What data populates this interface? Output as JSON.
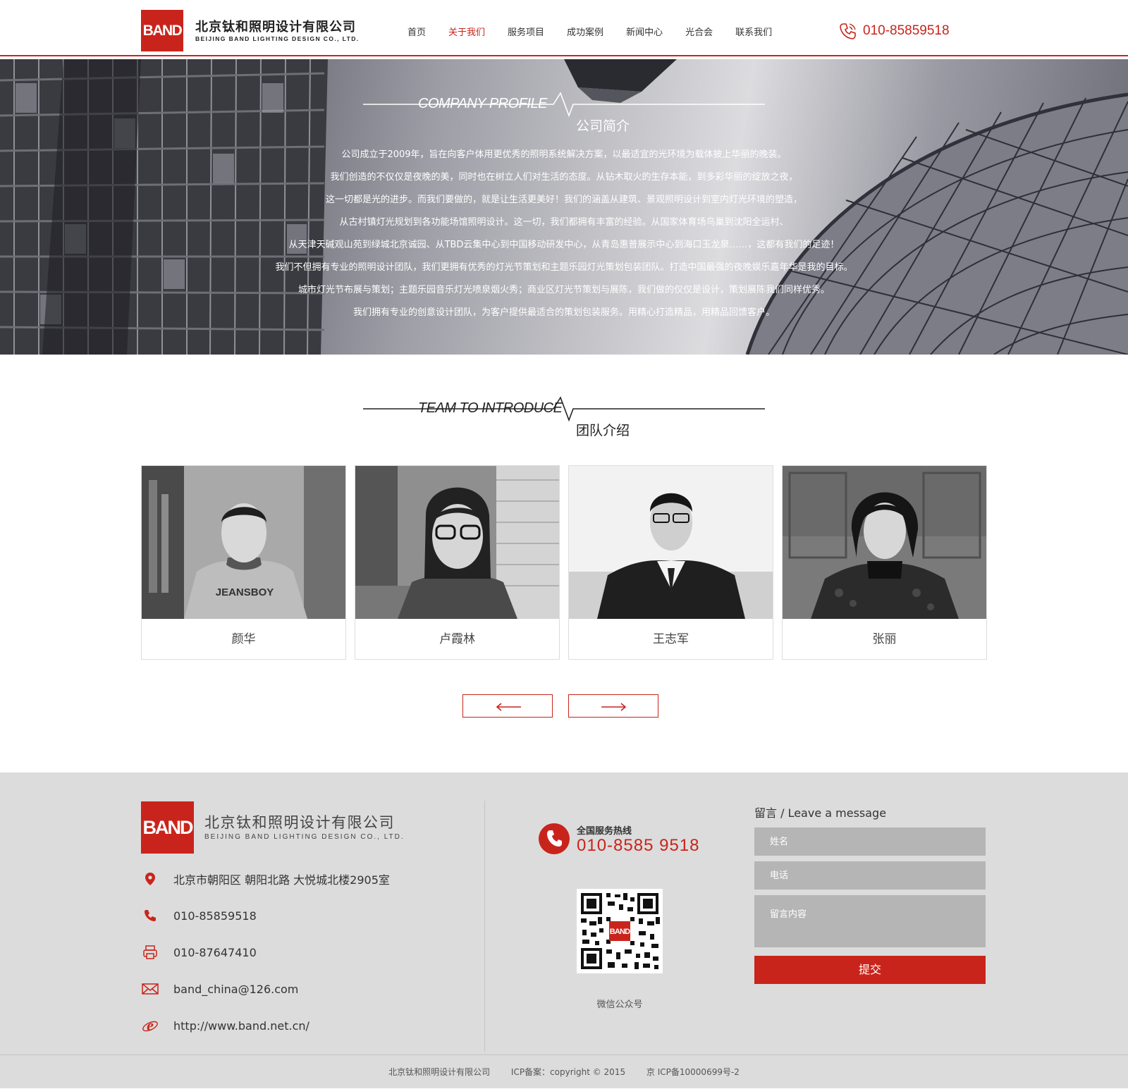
{
  "header": {
    "logo_text": "BAND",
    "company_cn": "北京钛和照明设计有限公司",
    "company_en": "BEIJING BAND LIGHTING DESIGN CO., LTD.",
    "nav": [
      {
        "label": "首页",
        "active": false
      },
      {
        "label": "关于我们",
        "active": true
      },
      {
        "label": "服务项目",
        "active": false
      },
      {
        "label": "成功案例",
        "active": false
      },
      {
        "label": "新闻中心",
        "active": false
      },
      {
        "label": "光合会",
        "active": false
      },
      {
        "label": "联系我们",
        "active": false
      }
    ],
    "phone": "010-85859518"
  },
  "profile": {
    "title_en": "COMPANY PROFILE",
    "title_cn": "公司简介",
    "lines": [
      "公司成立于2009年，旨在向客户体用更优秀的照明系统解决方案，以最适宜的光环境为载体披上华丽的晚装。",
      "我们创造的不仅仅是夜晚的美，同时也在树立人们对生活的态度。从钻木取火的生存本能，到多彩华丽的绽放之夜，",
      "这一切都是光的进步。而我们要做的，就是让生活更美好！我们的涵盖从建筑、景观照明设计到室内灯光环境的塑造，",
      "从古村镇灯光规划到各功能场馆照明设计。这一切，我们都拥有丰富的经验。从国家体育场鸟巢到沈阳全运村、",
      "从天津天碱观山苑到绿城北京诚园、从TBD云集中心到中国移动研发中心，从青岛惠普展示中心到海口玉龙泉……，这都有我们的足迹！",
      "我们不但拥有专业的照明设计团队，我们更拥有优秀的灯光节策划和主题乐园灯光策划包装团队。打造中国最强的夜晚娱乐嘉年华是我的目标。",
      "城市灯光节布展与策划；主题乐园音乐灯光喷泉烟火秀；商业区灯光节策划与展陈，我们做的仅仅是设计，策划展陈我们同样优秀。",
      "我们拥有专业的创意设计团队，为客户提供最适合的策划包装服务。用精心打造精品，用精品回馈客户。"
    ]
  },
  "team": {
    "title_en": "TEAM TO INTRODUCE",
    "title_cn": "团队介绍",
    "members": [
      {
        "name": "颜华",
        "shirt_text": "JEANSBOY"
      },
      {
        "name": "卢霞林"
      },
      {
        "name": "王志军"
      },
      {
        "name": "张丽"
      }
    ],
    "prev_icon": "arrow-left-icon",
    "next_icon": "arrow-right-icon"
  },
  "footer": {
    "logo_text": "BAND",
    "company_cn": "北京钛和照明设计有限公司",
    "company_en": "BEIJING BAND LIGHTING DESIGN CO., LTD.",
    "contacts": [
      {
        "icon": "location-pin-icon",
        "text": "北京市朝阳区 朝阳北路 大悦城北楼2905室"
      },
      {
        "icon": "phone-icon",
        "text": "010-85859518"
      },
      {
        "icon": "fax-printer-icon",
        "text": "010-87647410"
      },
      {
        "icon": "mail-icon",
        "text": "band_china@126.com"
      },
      {
        "icon": "browser-icon",
        "text": "http://www.band.net.cn/"
      }
    ],
    "hotline_label": "全国服务热线",
    "hotline_number": "010-8585 9518",
    "qr_logo_text": "BAND",
    "qr_label": "微信公众号",
    "message": {
      "title": "留言 / Leave a message",
      "name_placeholder": "姓名",
      "phone_placeholder": "电话",
      "content_placeholder": "留言内容",
      "submit_label": "提交"
    },
    "bottom": {
      "company": "北京钛和照明设计有限公司",
      "copyright": "ICP备案：copyright © 2015",
      "icp": "京 ICP备10000699号-2"
    }
  },
  "colors": {
    "accent": "#c9241b",
    "footer_bg": "#dcdcdc",
    "field_bg": "#b5b5b5"
  }
}
